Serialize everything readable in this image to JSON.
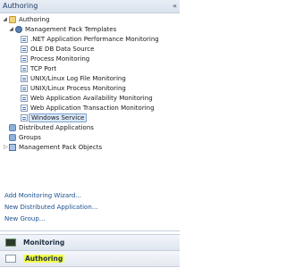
{
  "pane": {
    "title": "Authoring",
    "collapse_glyph": "«"
  },
  "tree": {
    "root": "Authoring",
    "mp_templates": "Management Pack Templates",
    "templates": [
      ".NET Application Performance Monitoring",
      "OLE DB Data Source",
      "Process Monitoring",
      "TCP Port",
      "UNIX/Linux Log File Monitoring",
      "UNIX/Linux Process Monitoring",
      "Web Application Availability Monitoring",
      "Web Application Transaction Monitoring",
      "Windows Service"
    ],
    "selected": "Windows Service",
    "distributed_apps": "Distributed Applications",
    "groups": "Groups",
    "mp_objects": "Management Pack Objects"
  },
  "links": {
    "add_wizard": "Add Monitoring Wizard...",
    "new_dist_app": "New Distributed Application...",
    "new_group": "New Group..."
  },
  "workspaces": {
    "monitoring": "Monitoring",
    "authoring": "Authoring"
  }
}
